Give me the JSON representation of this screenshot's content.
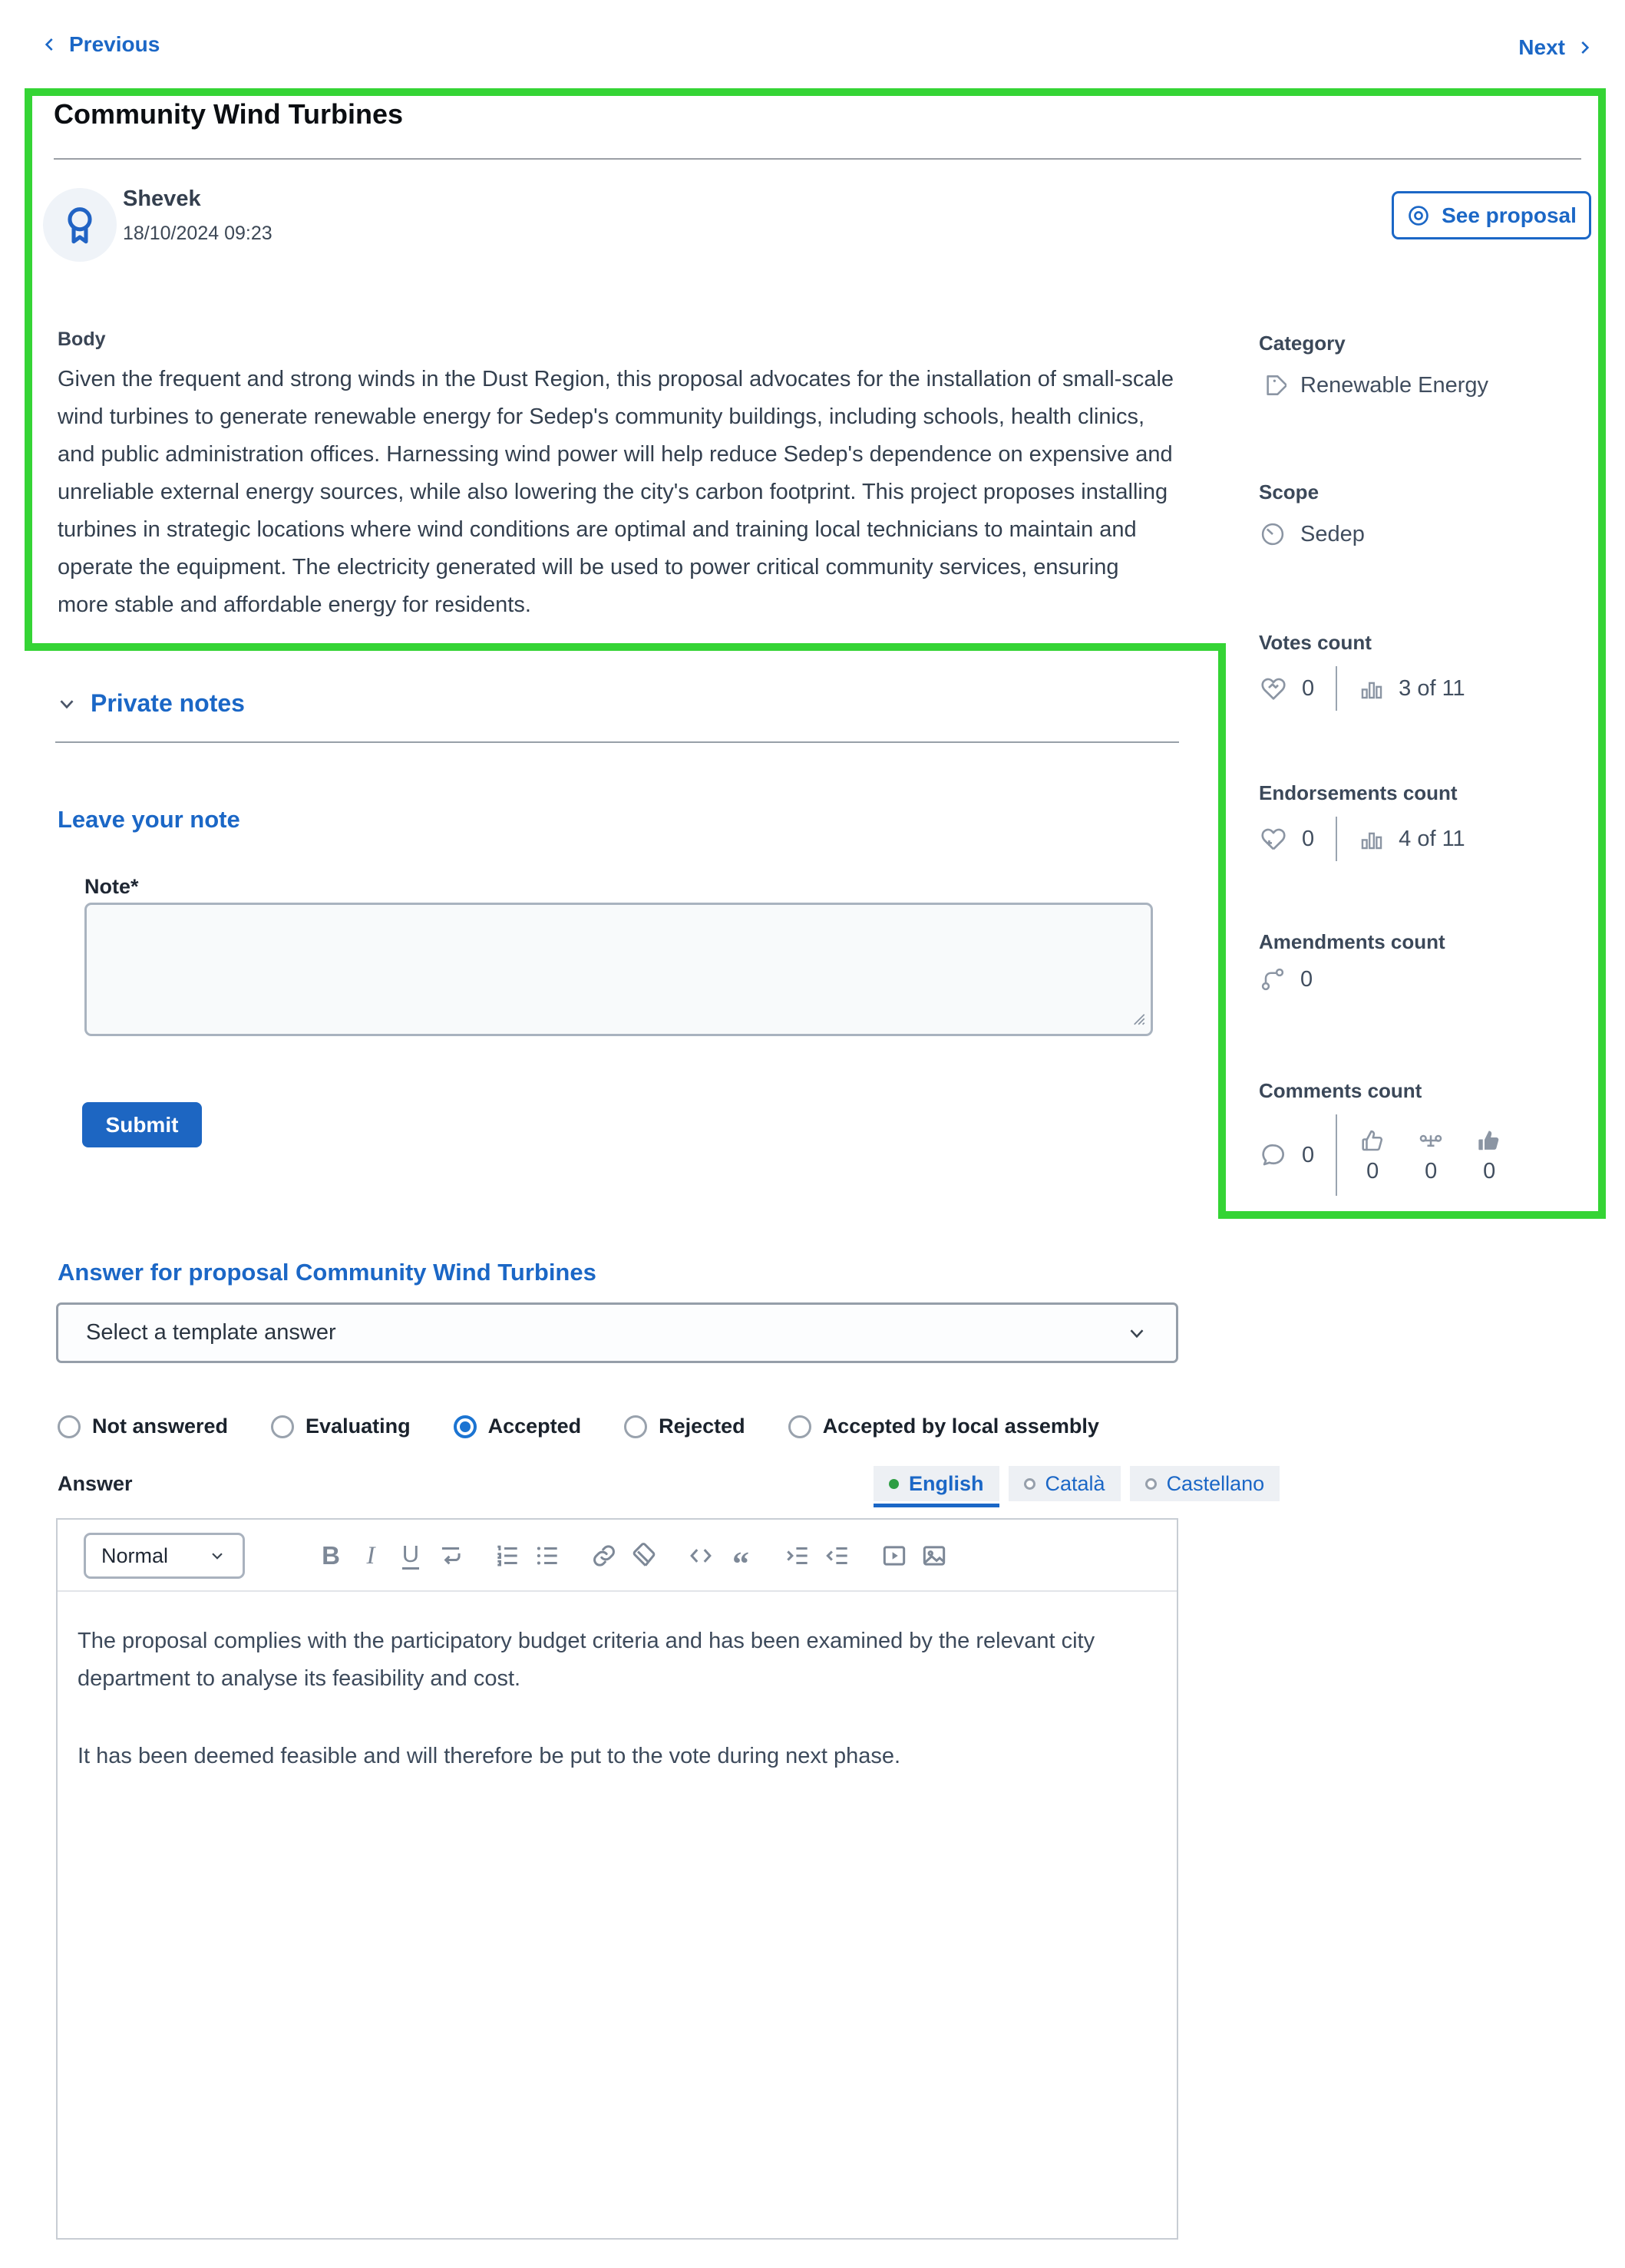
{
  "nav": {
    "previous": "Previous",
    "next": "Next"
  },
  "proposal": {
    "title": "Community Wind Turbines",
    "author": {
      "name": "Shevek",
      "date": "18/10/2024 09:23"
    },
    "see_proposal": "See proposal",
    "body_label": "Body",
    "body": "Given the frequent and strong winds in the Dust Region, this proposal advocates for the installation of small-scale wind turbines to generate renewable energy for Sedep's community buildings, including schools, health clinics, and public administration offices. Harnessing wind power will help reduce Sedep's dependence on expensive and unreliable external energy sources, while also lowering the city's carbon footprint. This project proposes installing turbines in strategic locations where wind conditions are optimal and training local technicians to maintain and operate the equipment. The electricity generated will be used to power critical community services, ensuring more stable and affordable energy for residents."
  },
  "sidebar": {
    "category": {
      "label": "Category",
      "value": "Renewable Energy"
    },
    "scope": {
      "label": "Scope",
      "value": "Sedep"
    },
    "votes": {
      "label": "Votes count",
      "count": "0",
      "ranking": "3 of 11"
    },
    "endorsements": {
      "label": "Endorsements count",
      "count": "0",
      "ranking": "4 of 11"
    },
    "amendments": {
      "label": "Amendments count",
      "count": "0"
    },
    "comments": {
      "label": "Comments count",
      "count": "0",
      "favor": "0",
      "neutral": "0",
      "against": "0"
    }
  },
  "notes": {
    "section_title": "Private notes",
    "heading": "Leave your note",
    "note_label": "Note*",
    "note_value": "",
    "submit_label": "Submit"
  },
  "answer": {
    "heading": "Answer for proposal Community Wind Turbines",
    "template_placeholder": "Select a template answer",
    "statuses": [
      {
        "label": "Not answered",
        "selected": false
      },
      {
        "label": "Evaluating",
        "selected": false
      },
      {
        "label": "Accepted",
        "selected": true
      },
      {
        "label": "Rejected",
        "selected": false
      },
      {
        "label": "Accepted by local assembly",
        "selected": false
      }
    ],
    "answer_label": "Answer",
    "languages": [
      {
        "label": "English",
        "active": true
      },
      {
        "label": "Català",
        "active": false
      },
      {
        "label": "Castellano",
        "active": false
      }
    ],
    "editor": {
      "format": "Normal",
      "toolbar_icons": [
        "bold",
        "italic",
        "underline",
        "soft-break",
        "ordered-list",
        "bullet-list",
        "link",
        "eraser",
        "code",
        "quote",
        "indent",
        "outdent",
        "video",
        "image"
      ],
      "paragraphs": [
        "The proposal complies with the participatory budget criteria and has been examined by the relevant city department to analyse its feasibility and cost.",
        "It has been deemed feasible and will therefore be put to the vote during next phase."
      ]
    }
  },
  "colors": {
    "accent_blue": "#1b67c6",
    "submit_blue": "#1d66c2",
    "annotation_green": "#35d435",
    "active_lang_dot": "#2e9e44"
  }
}
